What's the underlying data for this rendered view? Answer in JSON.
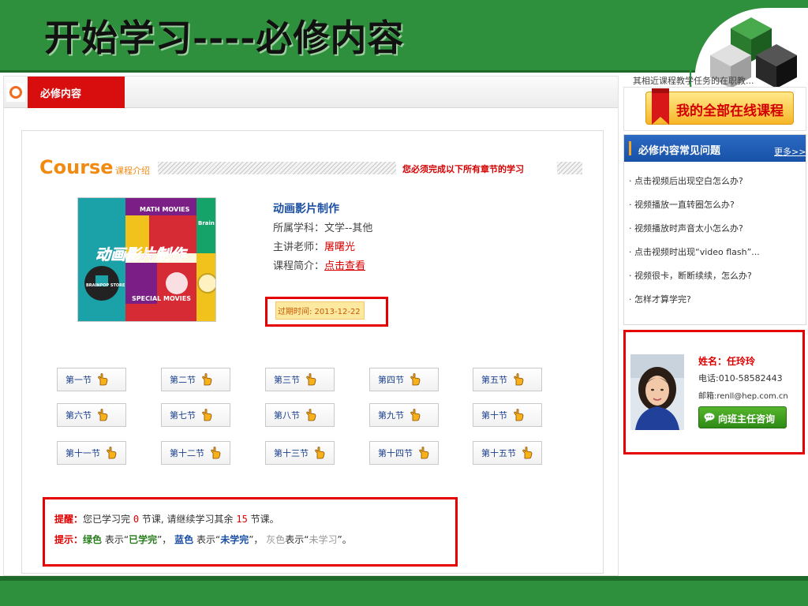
{
  "header": {
    "title": "开始学习----必修内容"
  },
  "tab": {
    "active_label": "必修内容"
  },
  "course": {
    "heading": "Course",
    "heading_sub": "课程介绍",
    "must_complete_text": "您必须完成以下所有章节的学习",
    "thumbnail": {
      "text_top": "MATH MOVIES",
      "text_mid": "动画影片制作",
      "text_left": "BRAINPOP STORE",
      "text_bottom": "SPECIAL MOVIES",
      "text_side": "Brain"
    },
    "name": "动画影片制作",
    "subject_label": "所属学科：",
    "subject_value": "文学--其他",
    "teacher_label": "主讲老师：",
    "teacher_value": "屠曙光",
    "intro_label": "课程简介：",
    "intro_link": "点击查看",
    "expire_text": "过期时间: 2013-12-22"
  },
  "chapters": [
    "第一节",
    "第二节",
    "第三节",
    "第四节",
    "第五节",
    "第六节",
    "第七节",
    "第八节",
    "第九节",
    "第十节",
    "第十一节",
    "第十二节",
    "第十三节",
    "第十四节",
    "第十五节"
  ],
  "reminder": {
    "label1": "提醒：",
    "text1a": "您已学习完 ",
    "completed": "0",
    "text1b": " 节课, 请继续学习其余 ",
    "remaining": "15",
    "text1c": " 节课。",
    "label2": "提示：",
    "green_word": "绿色",
    "means1": " 表示“",
    "done": "已学完",
    "sep1": "”， ",
    "blue_word": "蓝色",
    "means2": " 表示“",
    "not_done": "未学完",
    "sep2": "”， ",
    "gray_word": "灰色",
    "means3": "表示“",
    "not_started": "未学习",
    "end": "”。"
  },
  "right": {
    "top_text": "其相近课程教学任务的在职教...",
    "all_courses_button": "我的全部在线课程",
    "faq": {
      "title": "必修内容常见问题",
      "more": "更多>>",
      "items": [
        "· 点击视频后出现空白怎么办?",
        "· 视频播放一直转圈怎么办?",
        "· 视频播放时声音太小怎么办?",
        "· 点击视频时出现“video flash”...",
        "· 视频很卡，断断续续，怎么办?",
        "· 怎样才算学完?"
      ]
    },
    "teacher": {
      "name": "姓名：任玲玲",
      "phone": "电话:010-58582443",
      "email": "邮箱:renll@hep.com.cn",
      "ask_button": "向班主任咨询"
    }
  },
  "colors": {
    "banner_green": "#2e8f3c",
    "tab_red": "#d80e0e",
    "accent_orange": "#f28a12",
    "highlight_red": "#e40000",
    "faq_blue": "#1752a8"
  }
}
